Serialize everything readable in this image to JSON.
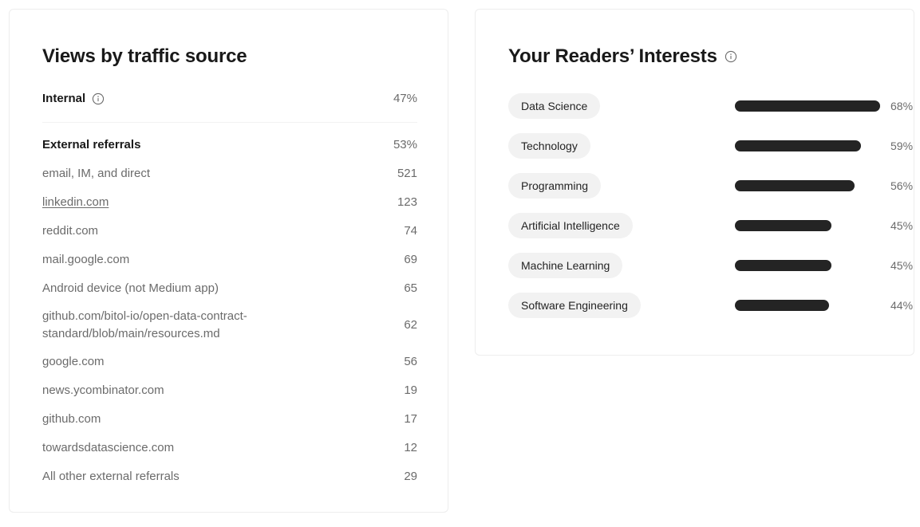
{
  "traffic_card": {
    "title": "Views by traffic source",
    "internal": {
      "label": "Internal",
      "value": "47%",
      "info_icon": "info-circle-icon"
    },
    "external": {
      "label": "External referrals",
      "value": "53%"
    },
    "referrals": [
      {
        "label": "email, IM, and direct",
        "value": "521",
        "link": false
      },
      {
        "label": "linkedin.com",
        "value": "123",
        "link": true
      },
      {
        "label": "reddit.com",
        "value": "74",
        "link": false
      },
      {
        "label": "mail.google.com",
        "value": "69",
        "link": false
      },
      {
        "label": "Android device (not Medium app)",
        "value": "65",
        "link": false
      },
      {
        "label": "github.com/bitol-io/open-data-contract-standard/blob/main/resources.md",
        "value": "62",
        "link": false
      },
      {
        "label": "google.com",
        "value": "56",
        "link": false
      },
      {
        "label": "news.ycombinator.com",
        "value": "19",
        "link": false
      },
      {
        "label": "github.com",
        "value": "17",
        "link": false
      },
      {
        "label": "towardsdatascience.com",
        "value": "12",
        "link": false
      },
      {
        "label": "All other external referrals",
        "value": "29",
        "link": false
      }
    ]
  },
  "interests_card": {
    "title": "Your Readers’ Interests",
    "info_icon": "info-circle-icon"
  },
  "chart_data": {
    "type": "bar",
    "title": "Your Readers’ Interests",
    "orientation": "horizontal",
    "xlabel": "",
    "ylabel": "",
    "xlim": [
      0,
      100
    ],
    "grid": false,
    "legend": false,
    "bar_color": "#242424",
    "categories": [
      "Data Science",
      "Technology",
      "Programming",
      "Artificial Intelligence",
      "Machine Learning",
      "Software Engineering"
    ],
    "values": [
      68,
      59,
      56,
      45,
      45,
      44
    ],
    "value_labels": [
      "68%",
      "59%",
      "56%",
      "45%",
      "45%",
      "44%"
    ]
  },
  "colors": {
    "text_primary": "#191919",
    "text_secondary": "#6B6B6B",
    "card_border": "#EDEDED",
    "divider": "#F2F2F2",
    "tag_bg": "#F2F2F2",
    "bar": "#242424",
    "background": "#FFFFFF"
  }
}
